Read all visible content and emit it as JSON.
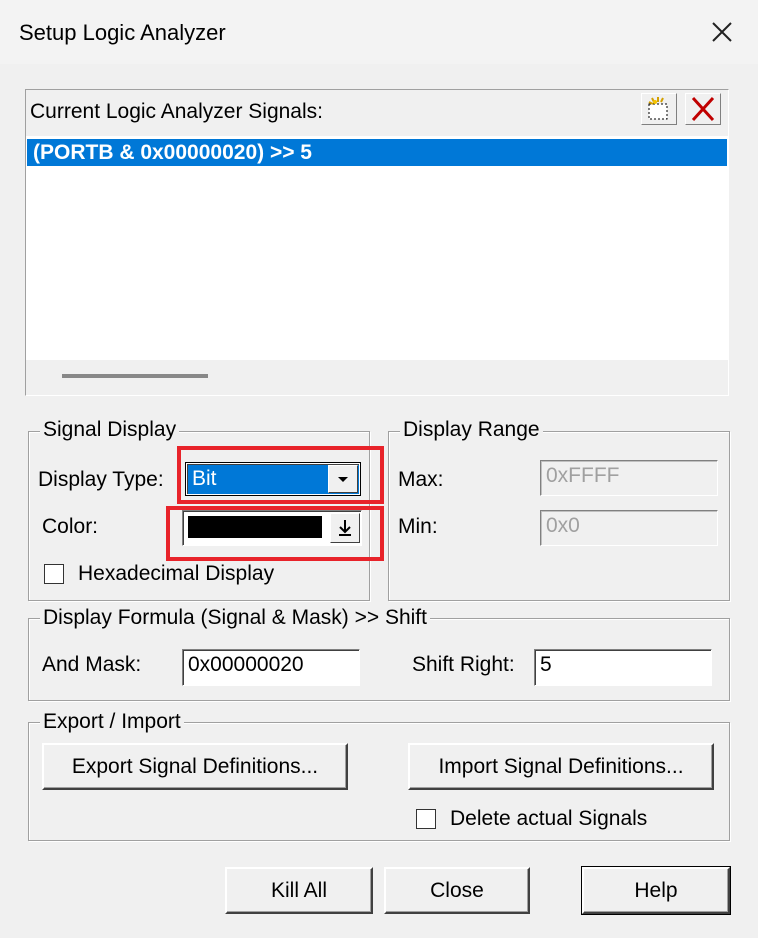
{
  "window": {
    "title": "Setup Logic Analyzer"
  },
  "signals": {
    "header_label": "Current Logic Analyzer Signals:",
    "items": [
      "(PORTB & 0x00000020) >> 5"
    ],
    "selected_index": 0,
    "new_button_icon": "new-signal-icon",
    "delete_button_icon": "delete-signal-icon"
  },
  "signal_display": {
    "title": "Signal Display",
    "display_type_label": "Display Type:",
    "display_type_value": "Bit",
    "color_label": "Color:",
    "color_value": "#000000",
    "hex_label": "Hexadecimal Display",
    "hex_checked": false
  },
  "display_range": {
    "title": "Display Range",
    "max_label": "Max:",
    "max_value": "0xFFFF",
    "min_label": "Min:",
    "min_value": "0x0"
  },
  "formula": {
    "title": "Display Formula (Signal & Mask) >> Shift",
    "and_mask_label": "And Mask:",
    "and_mask_value": "0x00000020",
    "shift_right_label": "Shift Right:",
    "shift_right_value": "5"
  },
  "export_import": {
    "title": "Export / Import",
    "export_label": "Export Signal Definitions...",
    "import_label": "Import Signal Definitions...",
    "delete_actual_label": "Delete actual Signals",
    "delete_actual_checked": false
  },
  "footer": {
    "kill_all": "Kill All",
    "close": "Close",
    "help": "Help"
  },
  "colors": {
    "selection": "#0078d7",
    "highlight_annotation": "#e8232a"
  }
}
